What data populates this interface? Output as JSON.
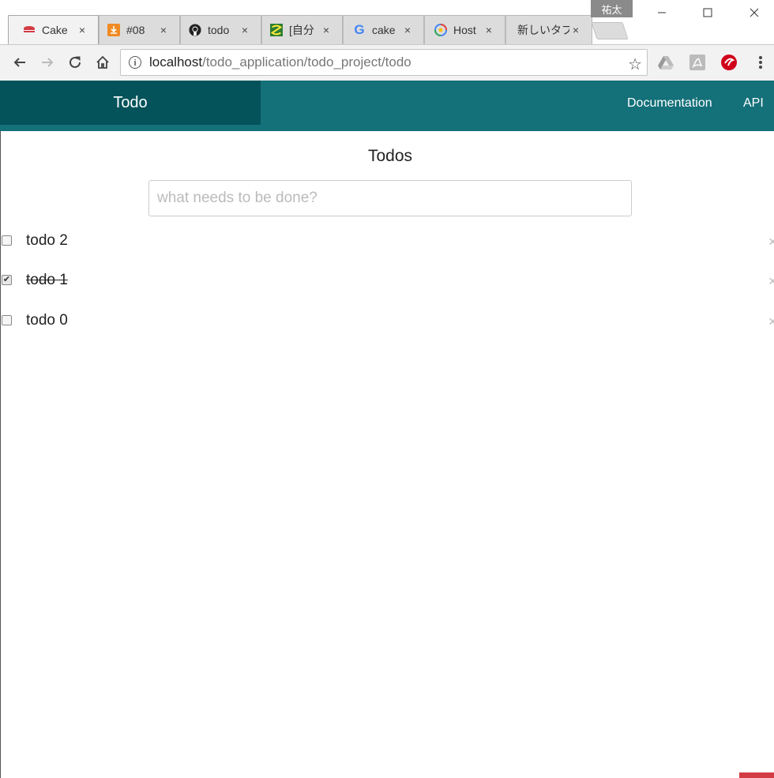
{
  "browser": {
    "profile_name": "祐太",
    "tabs": [
      {
        "label": "Cake",
        "icon": "cakephp-icon",
        "active": true
      },
      {
        "label": "#08",
        "icon": "download-icon",
        "active": false
      },
      {
        "label": "todo",
        "icon": "github-icon",
        "active": false
      },
      {
        "label": "[自分",
        "icon": "bookmark-icon",
        "active": false
      },
      {
        "label": "cake",
        "icon": "google-icon",
        "active": false
      },
      {
        "label": "Host",
        "icon": "host-icon",
        "active": false
      },
      {
        "label": "新しいタブ",
        "icon": "",
        "active": false
      }
    ],
    "close_glyph": "×",
    "url_host": "localhost",
    "url_path": "/todo_application/todo_project/todo"
  },
  "navbar": {
    "brand": "Todo",
    "links": [
      "Documentation",
      "API"
    ]
  },
  "main": {
    "heading": "Todos",
    "input_placeholder": "what needs to be done?",
    "todos": [
      {
        "title": "todo 2",
        "done": false
      },
      {
        "title": "todo 1",
        "done": true
      },
      {
        "title": "todo 0",
        "done": false
      }
    ]
  },
  "colors": {
    "navbar": "#147079",
    "brand_bg": "#04535a"
  }
}
